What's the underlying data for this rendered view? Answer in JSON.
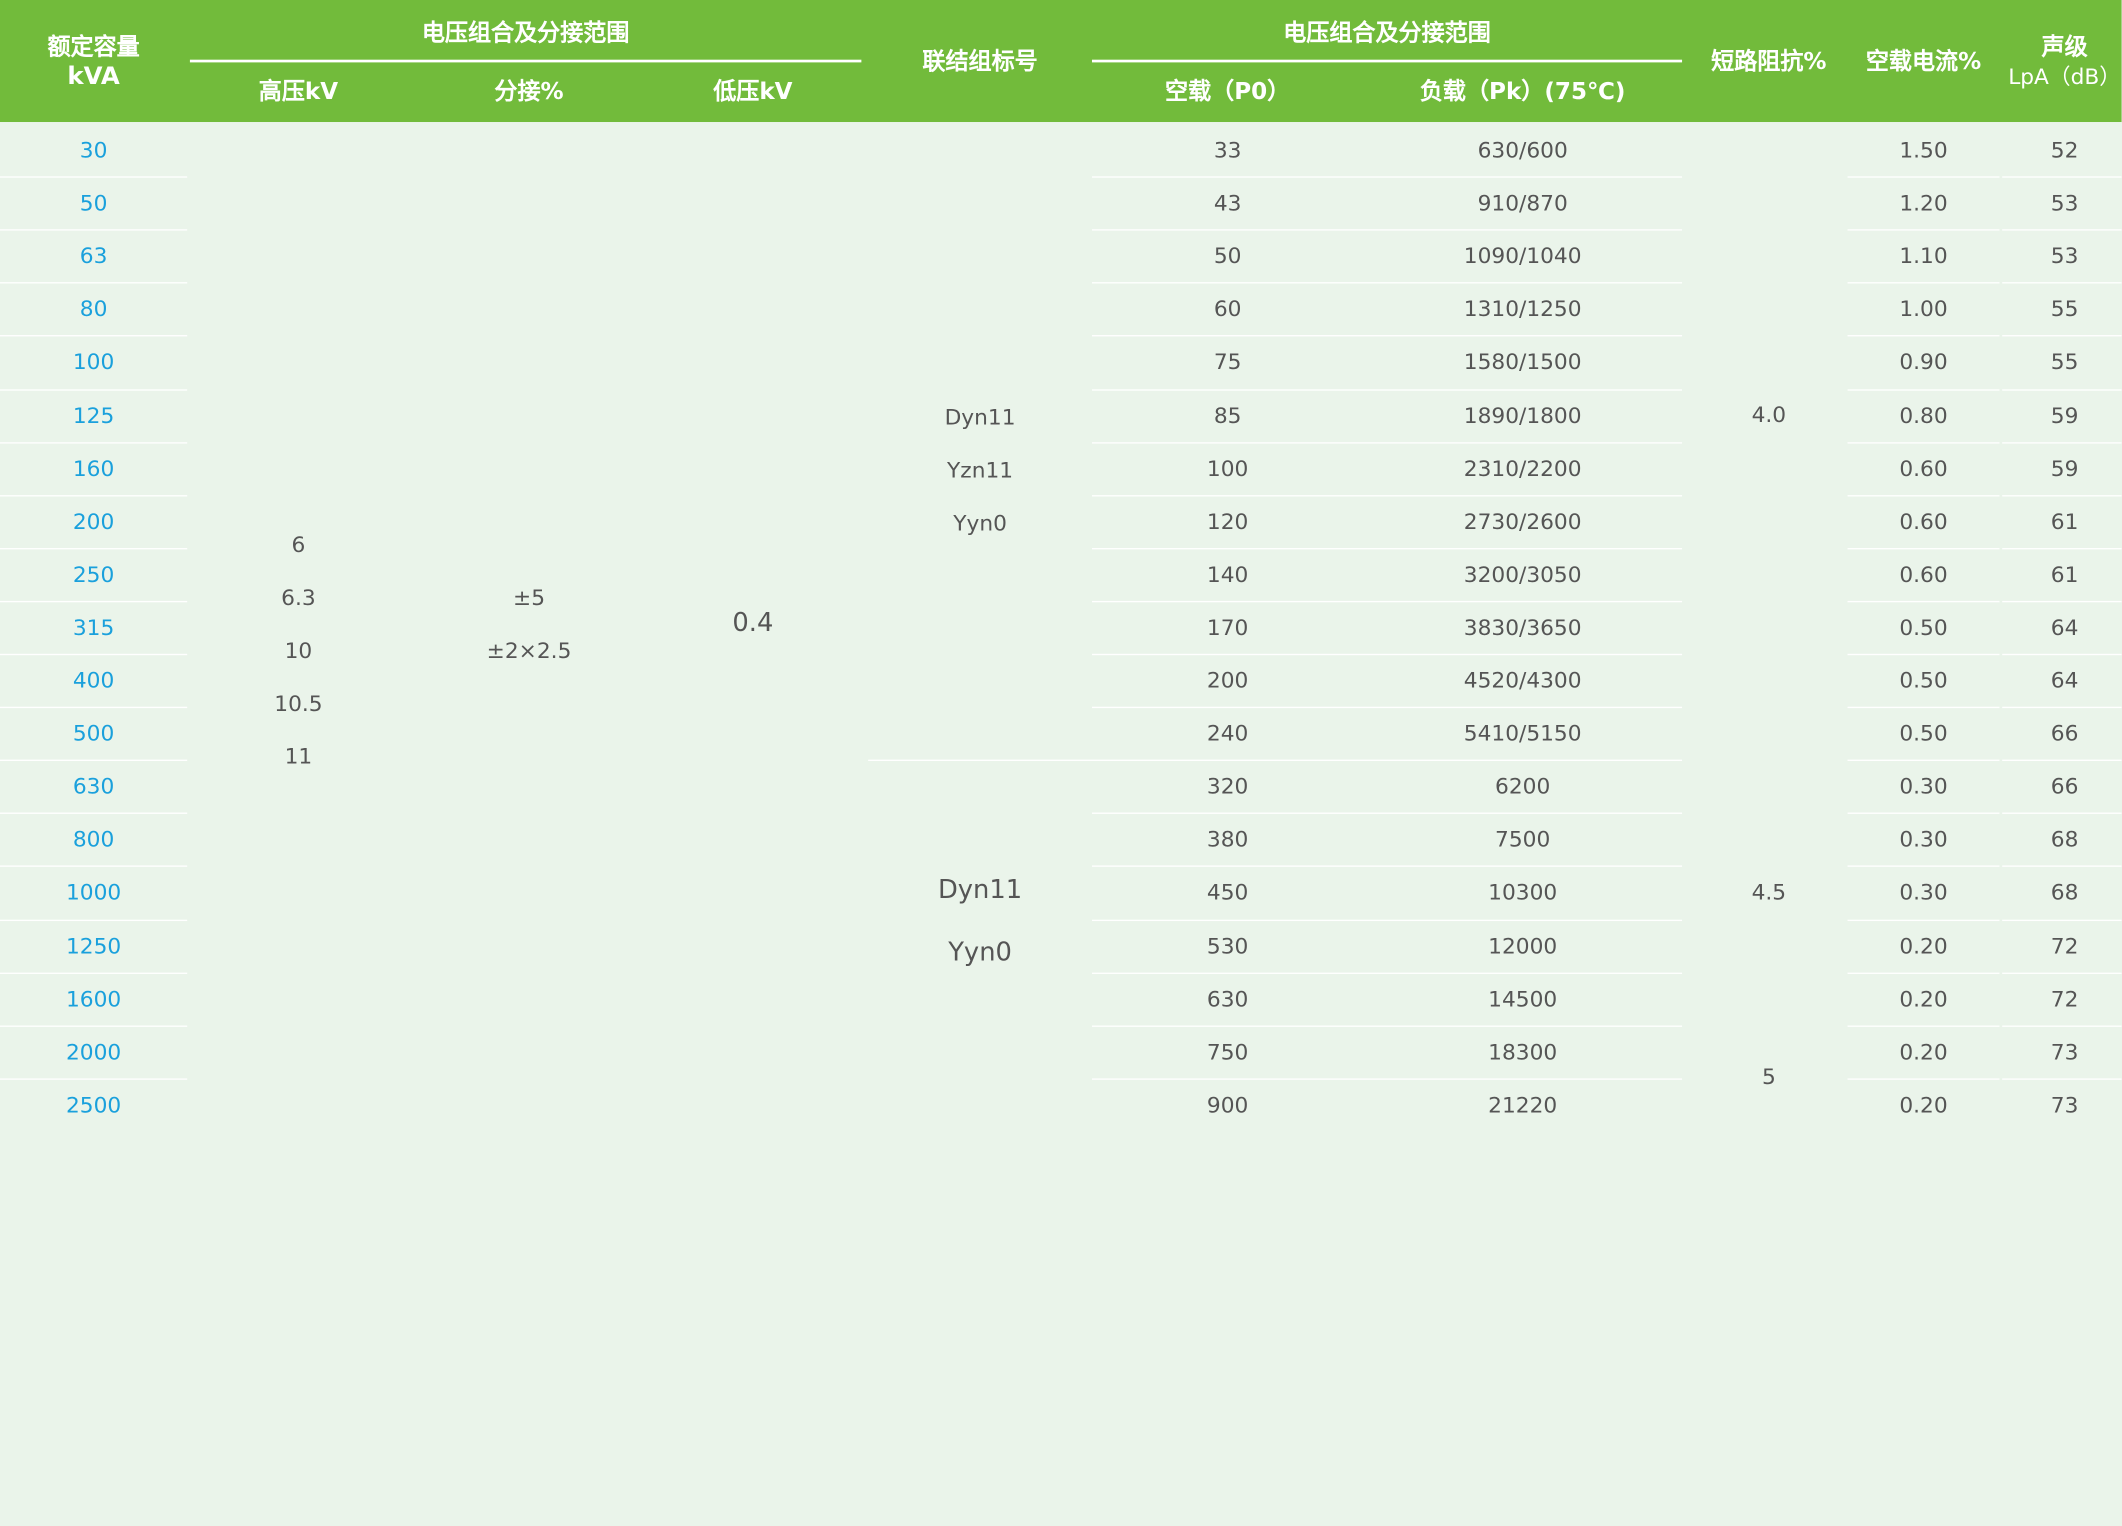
{
  "header": {
    "capacity": [
      "额定容量",
      "kVA"
    ],
    "voltage_group_1": "电压组合及分接范围",
    "hv": "高压kV",
    "tap": "分接%",
    "lv": "低压kV",
    "vector_group": "联结组标号",
    "voltage_group_2": "电压组合及分接范围",
    "no_load": "空载（P0）",
    "load": "负载（Pk）(75℃)",
    "impedance": "短路阻抗%",
    "no_load_current": "空载电流%",
    "noise": [
      "声级",
      "LpA（dB）"
    ]
  },
  "merged": {
    "hv_values": [
      "6",
      "6.3",
      "10",
      "10.5",
      "11"
    ],
    "tap_values": [
      "±5",
      "±2×2.5"
    ],
    "lv_value": "0.4",
    "vector_group_a": [
      "Dyn11",
      "Yzn11",
      "Yyn0"
    ],
    "vector_group_b": [
      "Dyn11",
      "Yyn0"
    ],
    "impedance_a": "4.0",
    "impedance_b": "4.5",
    "impedance_c": "5"
  },
  "rows": [
    {
      "kva": "30",
      "p0": "33",
      "pk": "630/600",
      "i0": "1.50",
      "noise": "52"
    },
    {
      "kva": "50",
      "p0": "43",
      "pk": "910/870",
      "i0": "1.20",
      "noise": "53"
    },
    {
      "kva": "63",
      "p0": "50",
      "pk": "1090/1040",
      "i0": "1.10",
      "noise": "53"
    },
    {
      "kva": "80",
      "p0": "60",
      "pk": "1310/1250",
      "i0": "1.00",
      "noise": "55"
    },
    {
      "kva": "100",
      "p0": "75",
      "pk": "1580/1500",
      "i0": "0.90",
      "noise": "55"
    },
    {
      "kva": "125",
      "p0": "85",
      "pk": "1890/1800",
      "i0": "0.80",
      "noise": "59"
    },
    {
      "kva": "160",
      "p0": "100",
      "pk": "2310/2200",
      "i0": "0.60",
      "noise": "59"
    },
    {
      "kva": "200",
      "p0": "120",
      "pk": "2730/2600",
      "i0": "0.60",
      "noise": "61"
    },
    {
      "kva": "250",
      "p0": "140",
      "pk": "3200/3050",
      "i0": "0.60",
      "noise": "61"
    },
    {
      "kva": "315",
      "p0": "170",
      "pk": "3830/3650",
      "i0": "0.50",
      "noise": "64"
    },
    {
      "kva": "400",
      "p0": "200",
      "pk": "4520/4300",
      "i0": "0.50",
      "noise": "64"
    },
    {
      "kva": "500",
      "p0": "240",
      "pk": "5410/5150",
      "i0": "0.50",
      "noise": "66"
    },
    {
      "kva": "630",
      "p0": "320",
      "pk": "6200",
      "i0": "0.30",
      "noise": "66"
    },
    {
      "kva": "800",
      "p0": "380",
      "pk": "7500",
      "i0": "0.30",
      "noise": "68"
    },
    {
      "kva": "1000",
      "p0": "450",
      "pk": "10300",
      "i0": "0.30",
      "noise": "68"
    },
    {
      "kva": "1250",
      "p0": "530",
      "pk": "12000",
      "i0": "0.20",
      "noise": "72"
    },
    {
      "kva": "1600",
      "p0": "630",
      "pk": "14500",
      "i0": "0.20",
      "noise": "72"
    },
    {
      "kva": "2000",
      "p0": "750",
      "pk": "18300",
      "i0": "0.20",
      "noise": "73"
    },
    {
      "kva": "2500",
      "p0": "900",
      "pk": "21220",
      "i0": "0.20",
      "noise": "73"
    }
  ],
  "colors": {
    "header_green": "#72bb3b",
    "body_bg": "#eaf4ea",
    "capacity_blue": "#1aa0dc",
    "text_gray": "#555555"
  }
}
